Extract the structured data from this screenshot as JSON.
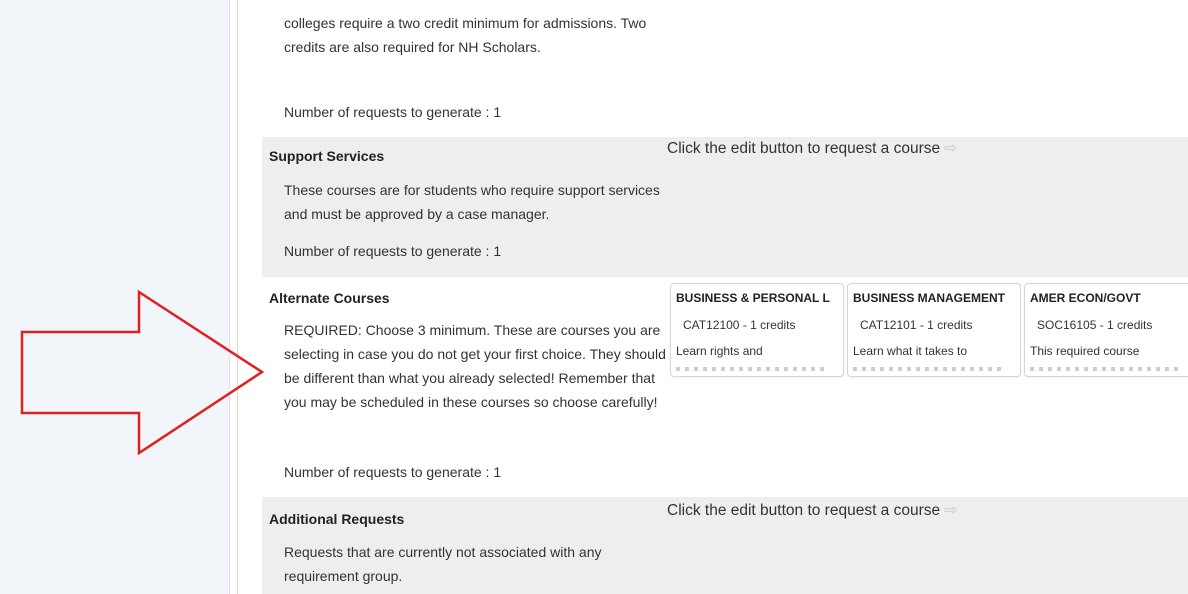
{
  "sections": {
    "top": {
      "desc": "colleges require a two credit minimum for admissions. Two credits are also required for NH Scholars.",
      "count": "Number of requests to generate : 1"
    },
    "support": {
      "title": "Support Services",
      "desc": "These courses are for students who require support services and must be approved by a case manager.",
      "count": "Number of requests to generate : 1",
      "hint": "Click the edit button to request a course"
    },
    "alternate": {
      "title": "Alternate Courses",
      "desc": "REQUIRED: Choose 3 minimum. These are courses you are selecting in case you do not get your first choice. They should be different than what you already selected! Remember that you may be scheduled in these courses so choose carefully!",
      "count": "Number of requests to generate : 1",
      "courses": [
        {
          "title": "BUSINESS & PERSONAL L",
          "code": "CAT12100 - 1 credits",
          "desc": "Learn rights and"
        },
        {
          "title": "BUSINESS MANAGEMENT",
          "code": "CAT12101 - 1 credits",
          "desc": "Learn what it takes to"
        },
        {
          "title": "AMER ECON/GOVT",
          "code": "SOC16105 - 1 credits",
          "desc": "This required course"
        }
      ]
    },
    "additional": {
      "title": "Additional Requests",
      "desc": "Requests that are currently not associated with any requirement group.",
      "hint": "Click the edit button to request a course"
    }
  },
  "icons": {
    "hint_arrow": "right-arrow-icon",
    "annotation_arrow": "red-outline-arrow"
  },
  "colors": {
    "annotation_arrow": "#e02020",
    "section_gray": "#eeeeee"
  }
}
